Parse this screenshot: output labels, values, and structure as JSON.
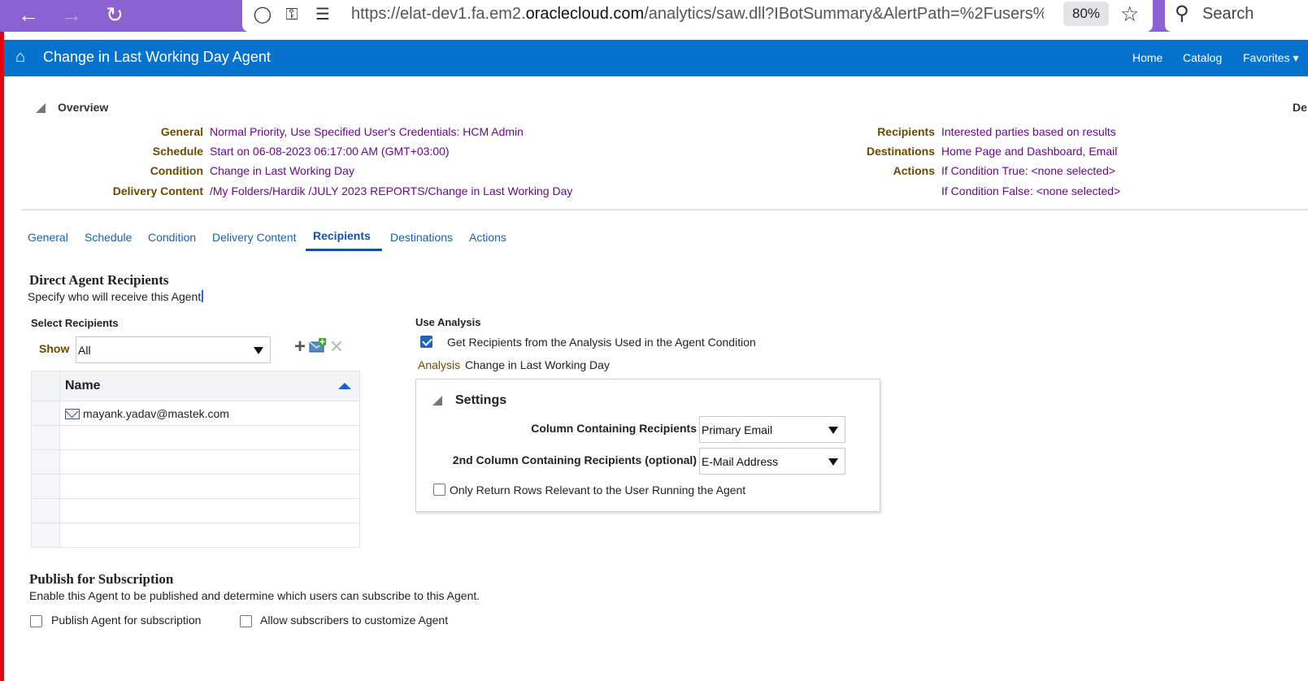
{
  "browser": {
    "url_prefix": "https://elat-dev1.fa.em2.",
    "url_domain": "oraclecloud.com",
    "url_path": "/analytics/saw.dll?IBotSummary&AlertPath=%2Fusers%",
    "zoom": "80%",
    "search_label": "Search"
  },
  "header": {
    "title": "Change in Last Working Day Agent",
    "links": {
      "home": "Home",
      "catalog": "Catalog",
      "favorites": "Favorites"
    }
  },
  "overview": {
    "title": "Overview",
    "cut_label": "De",
    "left": [
      {
        "label": "General",
        "value": "Normal Priority, Use Specified User's Credentials: HCM Admin"
      },
      {
        "label": "Schedule",
        "value": "Start on 06-08-2023 06:17:00 AM (GMT+03:00)"
      },
      {
        "label": "Condition",
        "value": "Change in Last Working Day"
      },
      {
        "label": "Delivery Content",
        "value": "/My Folders/Hardik /JULY 2023 REPORTS/Change in Last Working Day"
      }
    ],
    "right": [
      {
        "label": "Recipients",
        "value": "Interested parties based on results"
      },
      {
        "label": "Destinations",
        "value": "Home Page and Dashboard, Email"
      },
      {
        "label": "Actions",
        "value": "If Condition True: <none selected>"
      },
      {
        "label": "",
        "value": "If Condition False: <none selected>"
      }
    ]
  },
  "tabs": [
    "General",
    "Schedule",
    "Condition",
    "Delivery Content",
    "Recipients",
    "Destinations",
    "Actions"
  ],
  "active_tab": "Recipients",
  "direct": {
    "title": "Direct Agent Recipients",
    "desc": "Specify who will receive this Agent",
    "caret_char": "."
  },
  "select_recipients": {
    "label": "Select Recipients",
    "show_label": "Show",
    "show_value": "All",
    "table_header": "Name",
    "rows": [
      "mayank.yadav@mastek.com",
      "",
      "",
      "",
      "",
      ""
    ]
  },
  "use_analysis": {
    "label": "Use Analysis",
    "checkbox_label": "Get Recipients from the Analysis Used in the Agent Condition",
    "checked": true,
    "analysis_label": "Analysis",
    "analysis_value": "Change in Last Working Day",
    "settings": {
      "title": "Settings",
      "col1_label": "Column Containing Recipients",
      "col1_value": "Primary Email",
      "col2_label": "2nd Column Containing Recipients (optional)",
      "col2_value": "E-Mail Address",
      "only_rows_label": "Only Return Rows Relevant to the User Running the Agent"
    }
  },
  "publish": {
    "title": "Publish for Subscription",
    "desc": "Enable this Agent to be published and determine which users can subscribe to this Agent.",
    "publish_label": "Publish Agent for subscription",
    "allow_label": "Allow subscribers to customize Agent"
  },
  "colors": {
    "header_blue": "#0572ce",
    "browser_purple": "#8b60cf",
    "label_brown": "#6b4a00",
    "value_purple": "#6a0a8a",
    "link_blue": "#1a5fb0"
  }
}
